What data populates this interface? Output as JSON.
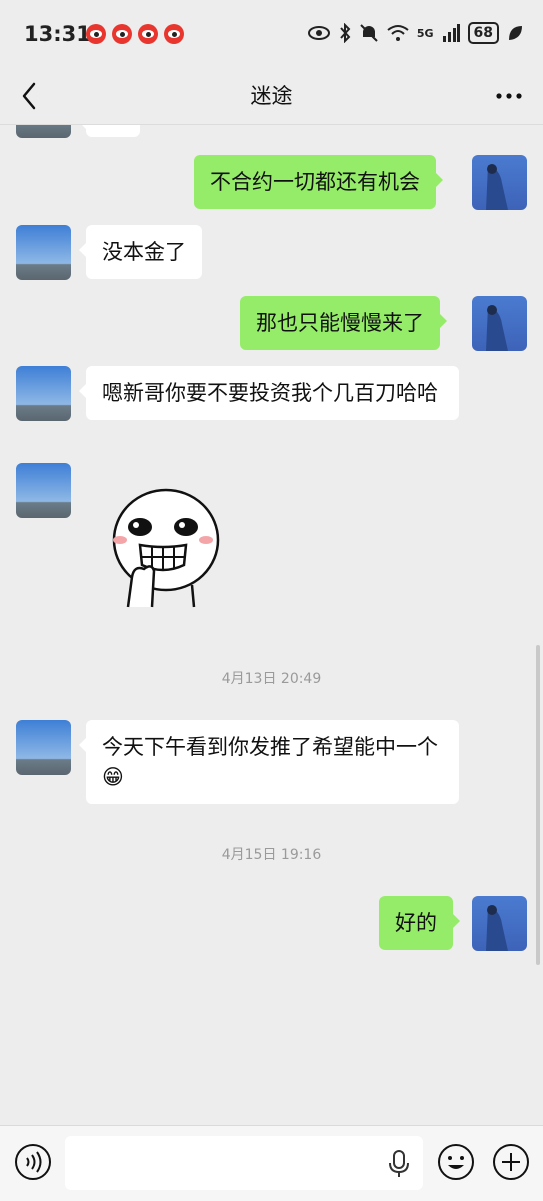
{
  "status": {
    "time": "13:31",
    "battery": "68",
    "signal_label": "5G"
  },
  "header": {
    "title": "迷途"
  },
  "messages": [
    {
      "side": "left",
      "text": ""
    },
    {
      "side": "right",
      "text": "不合约一切都还有机会"
    },
    {
      "side": "left",
      "text": "没本金了"
    },
    {
      "side": "right",
      "text": "那也只能慢慢来了"
    },
    {
      "side": "left",
      "text": "嗯新哥你要不要投资我个几百刀哈哈"
    },
    {
      "side": "left",
      "type": "sticker",
      "icon": "grinning-sticker"
    },
    {
      "side": "left",
      "text": "今天下午看到你发推了希望能中一个😁"
    },
    {
      "side": "right",
      "text": "好的"
    }
  ],
  "timestamps": [
    "4月13日 20:49",
    "4月15日 19:16"
  ],
  "input": {
    "placeholder": ""
  },
  "colors": {
    "background": "#ededed",
    "bubble_sent": "#95ec69",
    "bubble_received": "#ffffff"
  }
}
